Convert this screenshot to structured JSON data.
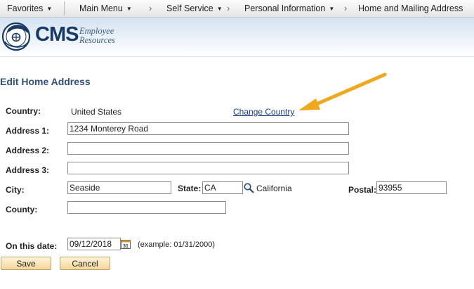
{
  "nav": {
    "favorites": "Favorites",
    "main_menu": "Main Menu",
    "self_service": "Self Service",
    "personal_information": "Personal Information",
    "home_mailing": "Home and Mailing Address",
    "separator": "›"
  },
  "branding": {
    "logo_text": "CMS",
    "logo_sub_line1": "Employee",
    "logo_sub_line2": "Resources"
  },
  "page": {
    "title": "Edit Home Address"
  },
  "form": {
    "country_label": "Country:",
    "country_value": "United States",
    "change_country_link": "Change Country",
    "address1_label": "Address 1:",
    "address1_value": "1234 Monterey Road",
    "address2_label": "Address 2:",
    "address2_value": "",
    "address3_label": "Address 3:",
    "address3_value": "",
    "city_label": "City:",
    "city_value": "Seaside",
    "state_label": "State:",
    "state_value": "CA",
    "state_name": "California",
    "postal_label": "Postal:",
    "postal_value": "93955",
    "county_label": "County:",
    "county_value": "",
    "date_label": "On this date:",
    "date_value": "09/12/2018",
    "date_example": "(example: 01/31/2000)",
    "calendar_icon_text": "31"
  },
  "buttons": {
    "save": "Save",
    "cancel": "Cancel"
  },
  "colors": {
    "title_blue": "#2e4f7a",
    "link_blue": "#1a3d88",
    "annotation_arrow": "#f0a81c",
    "button_fill": "#f5d79a"
  },
  "icons": {
    "lookup": "magnifier-icon",
    "calendar": "calendar-icon",
    "dropdown": "caret-down-icon",
    "annotation": "arrow-annotation"
  }
}
